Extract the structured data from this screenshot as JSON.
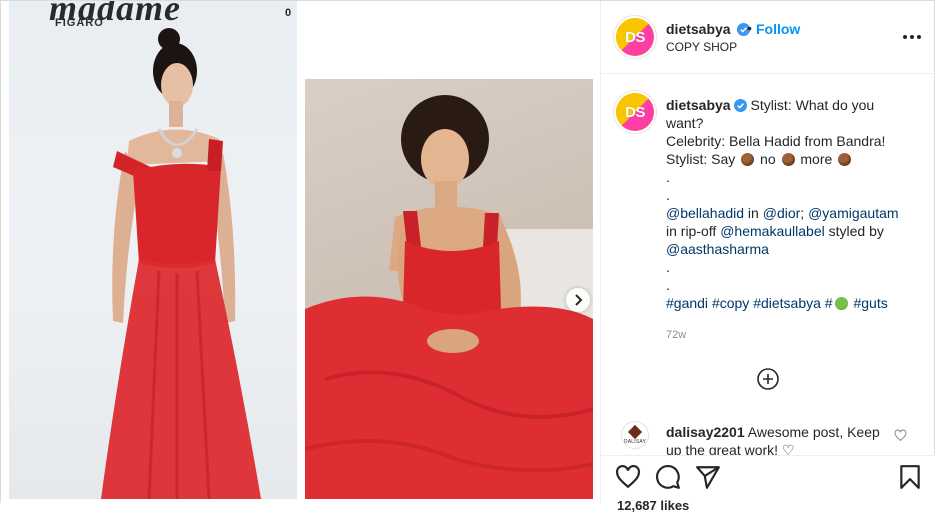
{
  "post": {
    "media": {
      "left_photo_alt": "Bella Hadid in red dress",
      "right_photo_alt": "Yami Gautam in red dress",
      "magazine_title": "madame",
      "magazine_sub": "FIGARO",
      "magazine_corner": "0",
      "next_label": "next"
    },
    "header": {
      "avatar_text": "DS",
      "username": "dietsabya",
      "dot": "•",
      "follow_label": "Follow",
      "subtitle": "COPY SHOP"
    },
    "caption": {
      "avatar_text": "DS",
      "username": "dietsabya",
      "line1": "Stylist: What do you",
      "line2": "want?",
      "line3": "Celebrity: Bella Hadid from Bandra!",
      "line4_a": "Stylist: Say",
      "line4_b": "no",
      "line4_c": "more",
      "dot1": ".",
      "dot2": ".",
      "mention1": "@bellahadid",
      "in1": " in ",
      "mention2": "@dior",
      "sep": "; ",
      "mention3": "@yamigautam",
      "in2": "in rip-off ",
      "mention4": "@hemakaullabel",
      "styled_by": " styled by",
      "mention5": "@aasthasharma",
      "dot3": ".",
      "dot4": ".",
      "hashtag1": "#gandi",
      "hashtag2": "#copy",
      "hashtag3": "#dietsabya",
      "hashtag4": "#",
      "hashtag5": "#guts",
      "timestamp": "72w"
    },
    "comment": {
      "avatar_brand": "DALISAY",
      "username": "dalisay2201",
      "text": "Awesome post, Keep",
      "text_cut": "up the great work! ♡"
    },
    "likes": "12,687 likes"
  },
  "colors": {
    "accent": "#0095f6",
    "link": "#00376b",
    "muted": "#8e8e8e",
    "dress_red": "#d8262b"
  },
  "icons": {
    "verified": "verified-badge-icon",
    "more": "more-options-icon",
    "add": "plus-circle-icon",
    "heart": "heart-icon",
    "comment": "comment-icon",
    "share": "share-icon",
    "save": "bookmark-icon",
    "next": "chevron-right-icon"
  }
}
